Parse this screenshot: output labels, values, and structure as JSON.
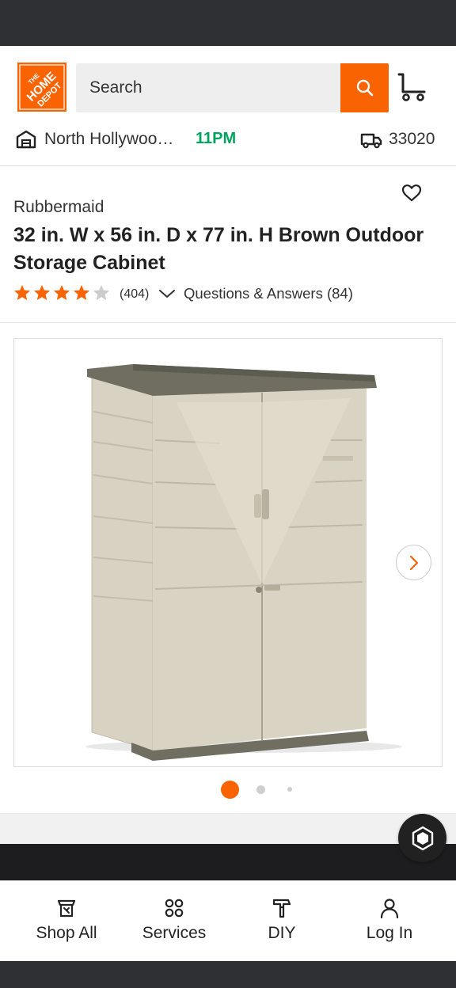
{
  "header": {
    "logo_text": "THE HOME DEPOT",
    "search_placeholder": "Search",
    "store_name": "North Hollywoo…",
    "store_hours": "11PM",
    "zip": "33020"
  },
  "product": {
    "brand": "Rubbermaid",
    "title": "32 in. W x 56 in. D x 77 in. H Brown Outdoor Storage Cabinet",
    "rating": 4,
    "rating_max": 5,
    "review_count": "(404)",
    "qa_link": "Questions & Answers (84)"
  },
  "gallery": {
    "image_count": 3,
    "current_image": 1
  },
  "bottom_nav": {
    "items": [
      {
        "label": "Shop All",
        "icon": "shop-all-icon"
      },
      {
        "label": "Services",
        "icon": "services-icon"
      },
      {
        "label": "DIY",
        "icon": "diy-icon"
      },
      {
        "label": "Log In",
        "icon": "user-icon"
      }
    ]
  },
  "colors": {
    "brand_orange": "#f96302",
    "hours_green": "#00a35f",
    "status_bar": "#2f3034"
  }
}
